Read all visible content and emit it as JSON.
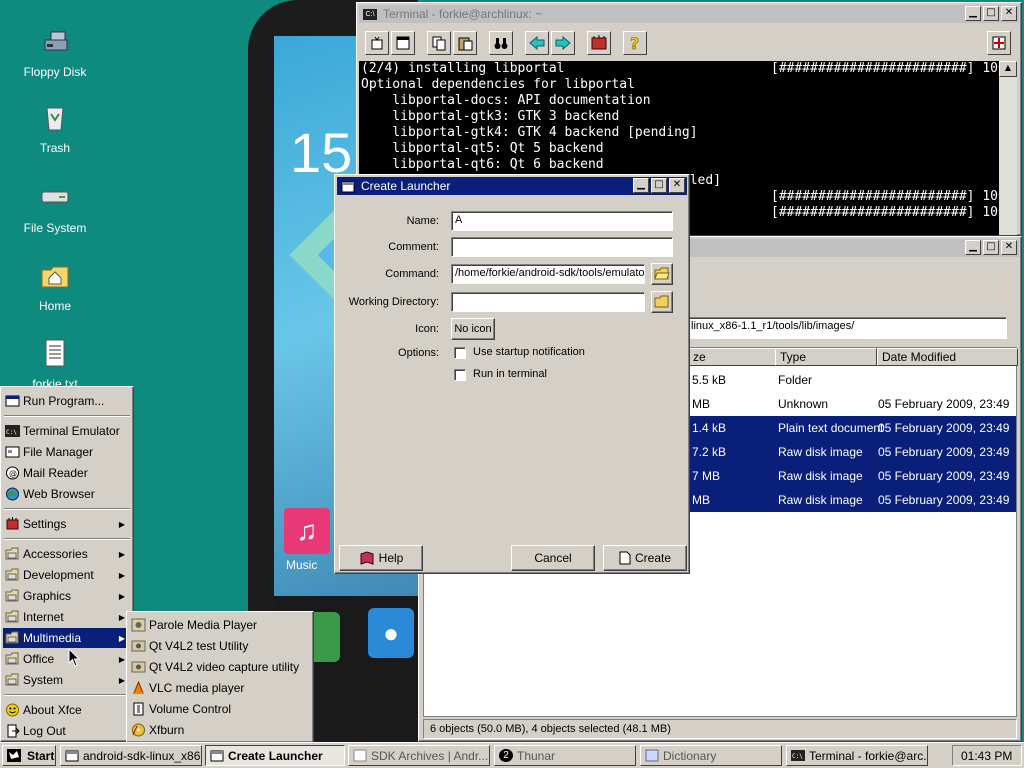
{
  "desktop": {
    "icons": [
      {
        "label": "Floppy Disk",
        "icon": "floppy-icon"
      },
      {
        "label": "Trash",
        "icon": "trash-icon"
      },
      {
        "label": "File System",
        "icon": "drive-icon"
      },
      {
        "label": "Home",
        "icon": "home-folder-icon"
      },
      {
        "label": "forkie.txt",
        "icon": "text-file-icon"
      }
    ],
    "phone_clock": "15",
    "phone_app_label": "Music"
  },
  "terminal": {
    "title": "Terminal - forkie@archlinux: ~",
    "lines": [
      {
        "text": "(2/4) installing libportal",
        "right": "[########################] 100%"
      },
      {
        "text": "Optional dependencies for libportal",
        "right": ""
      },
      {
        "text": "    libportal-docs: API documentation",
        "right": ""
      },
      {
        "text": "    libportal-gtk3: GTK 3 backend",
        "right": ""
      },
      {
        "text": "    libportal-gtk4: GTK 4 backend [pending]",
        "right": ""
      },
      {
        "text": "    libportal-qt5: Qt 5 backend",
        "right": ""
      },
      {
        "text": "    libportal-qt6: Qt 6 backend",
        "right": ""
      },
      {
        "text": "                                     nstalled]",
        "right": ""
      },
      {
        "text": "",
        "right": "[########################] 100%"
      },
      {
        "text": "",
        "right": "[########################] 100%"
      }
    ]
  },
  "file_manager": {
    "path": "linux_x86-1.1_r1/tools/lib/images/",
    "columns": [
      "ze",
      "Type",
      "Date Modified"
    ],
    "rows": [
      {
        "size": "5.5 kB",
        "type": "Folder",
        "date": "",
        "selected": false
      },
      {
        "size": "MB",
        "type": "Unknown",
        "date": "05 February 2009, 23:49",
        "selected": false
      },
      {
        "size": "1.4 kB",
        "type": "Plain text document",
        "date": "05 February 2009, 23:49",
        "selected": true
      },
      {
        "size": "7.2 kB",
        "type": "Raw disk image",
        "date": "05 February 2009, 23:49",
        "selected": true
      },
      {
        "size": "7 MB",
        "type": "Raw disk image",
        "date": "05 February 2009, 23:49",
        "selected": true
      },
      {
        "size": "MB",
        "type": "Raw disk image",
        "date": "05 February 2009, 23:49",
        "selected": true
      }
    ],
    "status": "6 objects (50.0 MB), 4 objects selected (48.1 MB)"
  },
  "dialog": {
    "title": "Create Launcher",
    "labels": {
      "name": "Name:",
      "comment": "Comment:",
      "command": "Command:",
      "workdir": "Working Directory:",
      "icon": "Icon:",
      "options": "Options:"
    },
    "values": {
      "name": "A",
      "comment": "",
      "command": "/home/forkie/android-sdk/tools/emulator",
      "workdir": ""
    },
    "icon_button": "No icon",
    "opt_startup": "Use startup notification",
    "opt_terminal": "Run in terminal",
    "help": "Help",
    "cancel": "Cancel",
    "create": "Create"
  },
  "start_menu": {
    "items": [
      {
        "label": "Run Program...",
        "icon": "run-icon",
        "arrow": false
      },
      {
        "label": "Terminal Emulator",
        "icon": "terminal-icon",
        "arrow": false
      },
      {
        "label": "File Manager",
        "icon": "file-manager-icon",
        "arrow": false
      },
      {
        "label": "Mail Reader",
        "icon": "mail-icon",
        "arrow": false
      },
      {
        "label": "Web Browser",
        "icon": "globe-icon",
        "arrow": false
      },
      {
        "label": "Settings",
        "icon": "settings-icon",
        "arrow": true
      },
      {
        "label": "Accessories",
        "icon": "folder-icon",
        "arrow": true
      },
      {
        "label": "Development",
        "icon": "folder-icon",
        "arrow": true
      },
      {
        "label": "Graphics",
        "icon": "folder-icon",
        "arrow": true
      },
      {
        "label": "Internet",
        "icon": "folder-icon",
        "arrow": true
      },
      {
        "label": "Multimedia",
        "icon": "folder-icon",
        "arrow": true
      },
      {
        "label": "Office",
        "icon": "folder-icon",
        "arrow": true
      },
      {
        "label": "System",
        "icon": "folder-icon",
        "arrow": true
      },
      {
        "label": "About Xfce",
        "icon": "smiley-icon",
        "arrow": false
      },
      {
        "label": "Log Out",
        "icon": "logout-icon",
        "arrow": false
      }
    ]
  },
  "submenu": {
    "items": [
      {
        "label": "Parole Media Player",
        "icon": "media-player-icon"
      },
      {
        "label": "Qt V4L2 test Utility",
        "icon": "webcam-icon"
      },
      {
        "label": "Qt V4L2 video capture utility",
        "icon": "webcam-icon"
      },
      {
        "label": "VLC media player",
        "icon": "vlc-cone-icon"
      },
      {
        "label": "Volume Control",
        "icon": "volume-icon"
      },
      {
        "label": "Xfburn",
        "icon": "disc-burn-icon"
      }
    ]
  },
  "taskbar": {
    "start": "Start",
    "tasks": [
      {
        "label": "android-sdk-linux_x86..."
      },
      {
        "label": "Create Launcher"
      },
      {
        "label": "SDK Archives | Andr..."
      },
      {
        "label": "Thunar"
      },
      {
        "label": "Dictionary"
      },
      {
        "label": "Terminal - forkie@arc..."
      }
    ],
    "badge": "2",
    "clock": "01:43 PM"
  },
  "colors": {
    "desktop": "#0f8a7f",
    "titlebar_active": "#0a1f7a",
    "selection": "#0a1f7a"
  }
}
